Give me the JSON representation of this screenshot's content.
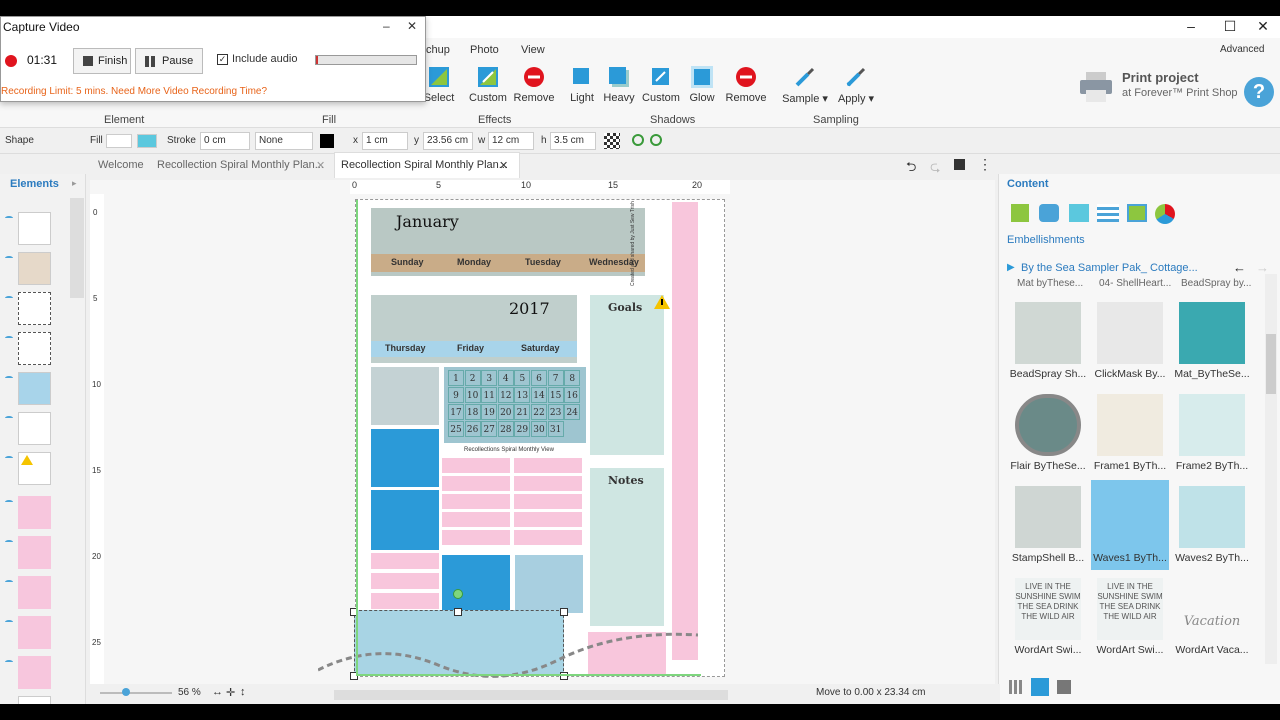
{
  "capture": {
    "title": "Capture Video",
    "minimize": "–",
    "close": "✕",
    "timer": "01:31",
    "finish_label": "Finish",
    "pause_label": "Pause",
    "include_audio_label": "Include audio",
    "include_audio_checked": true,
    "audio_level": 0.02,
    "limit_text": "Recording Limit: 5 mins. Need More Video Recording Time?",
    "colors": {
      "record": "#e0141e",
      "limit_text": "#e8641a"
    }
  },
  "window": {
    "minimize": "–",
    "maximize": "☐",
    "close": "✕"
  },
  "ribbon": {
    "tabs": [
      "chup",
      "Photo",
      "View"
    ],
    "advanced_label": "Advanced",
    "tools": [
      {
        "label": "Select",
        "icon": "select-icon"
      },
      {
        "label": "Custom",
        "icon": "custom-icon"
      },
      {
        "label": "Remove",
        "icon": "remove-icon"
      },
      {
        "label": "Light",
        "icon": "light-shadow-icon"
      },
      {
        "label": "Heavy",
        "icon": "heavy-shadow-icon"
      },
      {
        "label": "Custom",
        "icon": "custom-shadow-icon"
      },
      {
        "label": "Glow",
        "icon": "glow-icon"
      },
      {
        "label": "Remove",
        "icon": "remove-shadow-icon"
      },
      {
        "label": "Sample ▾",
        "icon": "sample-icon"
      },
      {
        "label": "Apply ▾",
        "icon": "apply-icon"
      }
    ],
    "groups": [
      "Element",
      "Fill",
      "Effects",
      "Shadows",
      "Sampling"
    ],
    "print": {
      "title": "Print project",
      "subtitle": "at Forever™ Print Shop"
    },
    "help_label": "?"
  },
  "propbar": {
    "shape_label": "Shape",
    "fill_label": "Fill",
    "stroke_label": "Stroke",
    "stroke_value": "0 cm",
    "stroke_style": "None",
    "x_label": "x",
    "x_value": "1 cm",
    "y_label": "y",
    "y_value": "23.56 cm",
    "w_label": "w",
    "w_value": "12 cm",
    "h_label": "h",
    "h_value": "3.5 cm"
  },
  "doctabs": {
    "tabs": [
      {
        "label": "Welcome"
      },
      {
        "label": "Recollection Spiral Monthly Plan..."
      },
      {
        "label": "Recollection Spiral Monthly Plan...",
        "active": true
      }
    ],
    "close": "✕"
  },
  "leftpanel": {
    "title": "Elements",
    "arrow": "▸"
  },
  "ruler": {
    "h_ticks": [
      "0",
      "5",
      "10",
      "15",
      "20"
    ],
    "v_ticks": [
      "0",
      "5",
      "10",
      "15",
      "20",
      "25"
    ]
  },
  "planner": {
    "month": "January",
    "year": "2017",
    "days_top": [
      "Sunday",
      "Monday",
      "Tuesday",
      "Wednesday"
    ],
    "days_mid": [
      "Thursday",
      "Friday",
      "Saturday"
    ],
    "credit": "Created and shared by Just Sew Trish",
    "goals": "Goals",
    "notes": "Notes",
    "calendar": [
      "1",
      "2",
      "3",
      "4",
      "5",
      "6",
      "7",
      "8",
      "9",
      "10",
      "11",
      "12",
      "13",
      "14",
      "15",
      "16",
      "17",
      "18",
      "19",
      "20",
      "21",
      "22",
      "23",
      "24",
      "25",
      "26",
      "27",
      "28",
      "29",
      "30",
      "31"
    ],
    "calendar_caption": "Recollections Spiral Monthly View",
    "colors": {
      "pink": "#f8c6dc",
      "blue": "#2b9ad8",
      "light_blue": "#a8d4ea"
    }
  },
  "rightpanel": {
    "title": "Content",
    "section": "Embellishments",
    "collection": "By the Sea Sampler Pak_ Cottage...",
    "partial_row": [
      "Mat byThese...",
      "04- ShellHeart...",
      "BeadSpray by..."
    ],
    "items": [
      {
        "label": "BeadSpray Sh...",
        "icon": "beadspray-icon"
      },
      {
        "label": "ClickMask By...",
        "icon": "clickmask-icon"
      },
      {
        "label": "Mat_ByTheSe...",
        "icon": "mat-icon"
      },
      {
        "label": "Flair ByTheSe...",
        "icon": "flair-icon"
      },
      {
        "label": "Frame1 ByTh...",
        "icon": "frame1-icon"
      },
      {
        "label": "Frame2 ByTh...",
        "icon": "frame2-icon"
      },
      {
        "label": "StampShell B...",
        "icon": "stampshell-icon"
      },
      {
        "label": "Waves1 ByTh...",
        "icon": "waves1-icon",
        "selected": true
      },
      {
        "label": "Waves2 ByTh...",
        "icon": "waves2-icon"
      },
      {
        "label": "WordArt Swi...",
        "icon": "wordart-icon"
      },
      {
        "label": "WordArt Swi...",
        "icon": "wordart2-icon"
      },
      {
        "label": "WordArt Vaca...",
        "icon": "wordart-vacation-icon"
      }
    ],
    "wordart_text": "LIVE IN THE SUNSHINE SWIM THE SEA DRINK THE WILD AIR",
    "wordart_vacation": "Vacation"
  },
  "statusbar": {
    "zoom": "56 %",
    "move_text": "Move to 0.00 x 23.34 cm"
  }
}
